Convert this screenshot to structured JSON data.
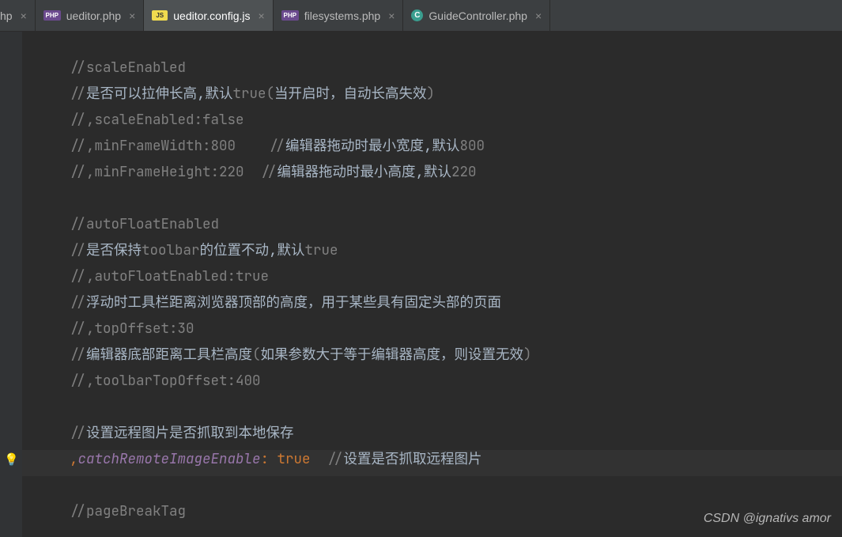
{
  "tabs": [
    {
      "label": "hp",
      "icon": "",
      "type": "partial"
    },
    {
      "label": "ueditor.php",
      "icon": "PHP",
      "iconClass": "php-icon"
    },
    {
      "label": "ueditor.config.js",
      "icon": "JS",
      "iconClass": "js-icon",
      "active": true
    },
    {
      "label": "filesystems.php",
      "icon": "PHP",
      "iconClass": "php-icon"
    },
    {
      "label": "GuideController.php",
      "icon": "C",
      "iconClass": "c-icon"
    }
  ],
  "code": {
    "l1": "//scaleEnabled",
    "l2a": "//",
    "l2b": "是否可以拉伸长高,默认",
    "l2c": "true(",
    "l2d": "当开启时，自动长高失效",
    "l2e": ")",
    "l3": "//,scaleEnabled:false",
    "l4a": "//,minFrameWidth:800    //",
    "l4b": "编辑器拖动时最小宽度,默认",
    "l4c": "800",
    "l5a": "//,minFrameHeight:220  //",
    "l5b": "编辑器拖动时最小高度,默认",
    "l5c": "220",
    "l6": "//autoFloatEnabled",
    "l7a": "//",
    "l7b": "是否保持",
    "l7c": "toolbar",
    "l7d": "的位置不动,默认",
    "l7e": "true",
    "l8": "//,autoFloatEnabled:true",
    "l9a": "//",
    "l9b": "浮动时工具栏距离浏览器顶部的高度，用于某些具有固定头部的页面",
    "l10": "//,topOffset:30",
    "l11a": "//",
    "l11b": "编辑器底部距离工具栏高度",
    "l11c": "(",
    "l11d": "如果参数大于等于编辑器高度，则设置无效",
    "l11e": ")",
    "l12": "//,toolbarTopOffset:400",
    "l13a": "//",
    "l13b": "设置远程图片是否抓取到本地保存",
    "l14a": ",",
    "l14b": "catchRemoteImageEnable",
    "l14c": ": ",
    "l14d": "true",
    "l14e": "  //",
    "l14f": "设置是否抓取远程图片",
    "l15": "//pageBreakTag"
  },
  "watermark": "CSDN @ignativs  amor"
}
